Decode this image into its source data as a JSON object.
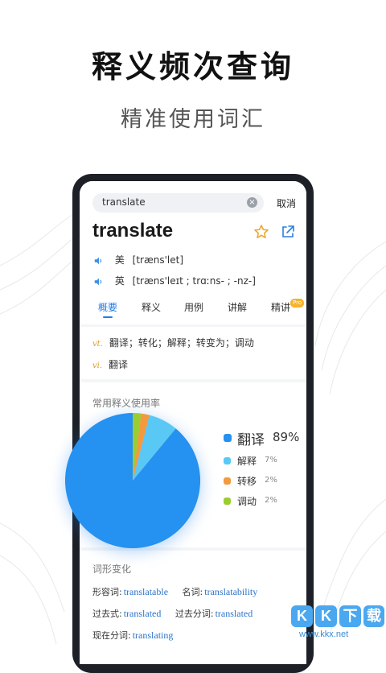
{
  "headline": "释义频次查询",
  "subline": "精准使用词汇",
  "search": {
    "value": "translate",
    "cancel_label": "取消"
  },
  "entry": {
    "word": "translate",
    "pron_us": {
      "region": "美",
      "ipa": "[træns'let]"
    },
    "pron_uk": {
      "region": "英",
      "ipa": "[træns'leɪt ; trɑːns- ; -nz-]"
    }
  },
  "tabs": [
    {
      "label": "概要",
      "active": true
    },
    {
      "label": "释义"
    },
    {
      "label": "用例"
    },
    {
      "label": "讲解"
    },
    {
      "label": "精讲",
      "badge": "Pro"
    }
  ],
  "definitions": [
    {
      "pos": "vt.",
      "text": "翻译；转化；解释；转变为；调动"
    },
    {
      "pos": "vi.",
      "text": "翻译"
    }
  ],
  "usage": {
    "title": "常用释义使用率",
    "items": [
      {
        "label": "翻译",
        "percent": "89%",
        "value": 89,
        "color": "#2591f0"
      },
      {
        "label": "解释",
        "percent": "7%",
        "value": 7,
        "color": "#5ac8f5"
      },
      {
        "label": "转移",
        "percent": "2%",
        "value": 2,
        "color": "#f39a3e"
      },
      {
        "label": "调动",
        "percent": "2%",
        "value": 2,
        "color": "#9acd32"
      }
    ]
  },
  "forms": {
    "title": "词形变化",
    "rows": [
      [
        {
          "label": "形容词:",
          "value": "translatable"
        },
        {
          "label": "名词:",
          "value": "translatability"
        }
      ],
      [
        {
          "label": "过去式:",
          "value": "translated"
        },
        {
          "label": "过去分词:",
          "value": "translated"
        }
      ],
      [
        {
          "label": "现在分词:",
          "value": "translating"
        }
      ]
    ]
  },
  "watermark": {
    "letters": [
      "K",
      "K",
      "下",
      "载"
    ],
    "site": "www.kkx.net"
  },
  "colors": {
    "accent": "#1e7ee8",
    "pos": "#e39a23",
    "form_value": "#2a72c8"
  },
  "icons": {
    "clear": "clear-icon",
    "star": "star-icon",
    "share": "share-icon",
    "speaker": "speaker-icon"
  }
}
